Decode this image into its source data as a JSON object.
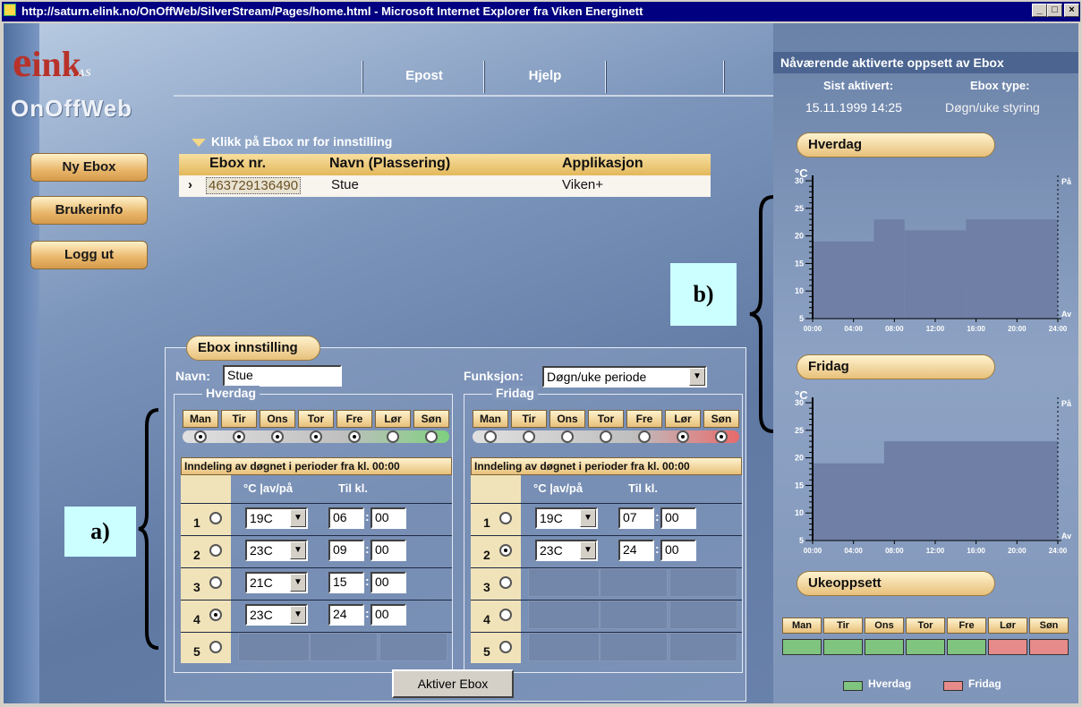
{
  "window": {
    "title": "http://saturn.elink.no/OnOffWeb/SilverStream/Pages/home.html - Microsoft Internet Explorer fra Viken Energinett",
    "min_label": "_",
    "max_label": "□",
    "close_label": "×"
  },
  "logo": {
    "line1": "ink",
    "line1_suffix": "AS",
    "line2": "OnOffWeb"
  },
  "topnav": {
    "items": [
      "Epost",
      "Hjelp"
    ]
  },
  "sidebar": {
    "buttons": [
      "Ny Ebox",
      "Brukerinfo",
      "Logg ut"
    ]
  },
  "ebox_list": {
    "heading": "Klikk på Ebox nr for innstilling",
    "columns": [
      "Ebox nr.",
      "Navn (Plassering)",
      "Applikasjon"
    ],
    "rows": [
      {
        "ebox_nr": "463729136490",
        "navn": "Stue",
        "applikasjon": "Viken+"
      }
    ]
  },
  "annotations": {
    "a": "a)",
    "b": "b)"
  },
  "settings": {
    "title": "Ebox innstilling",
    "navn_label": "Navn:",
    "navn_value": "Stue",
    "funksjon_label": "Funksjon:",
    "funksjon_value": "Døgn/uke periode",
    "days": [
      "Man",
      "Tir",
      "Ons",
      "Tor",
      "Fre",
      "Lør",
      "Søn"
    ],
    "hverdag": {
      "title": "Hverdag",
      "selected_days": [
        true,
        true,
        true,
        true,
        true,
        false,
        false
      ],
      "division_label": "Inndeling av døgnet i perioder fra kl. 00:00",
      "col_temp": "°C |av/på",
      "col_til": "Til kl.",
      "periods": [
        {
          "n": "1",
          "on": false,
          "temp": "19C",
          "hh": "06",
          "mm": "00"
        },
        {
          "n": "2",
          "on": false,
          "temp": "23C",
          "hh": "09",
          "mm": "00"
        },
        {
          "n": "3",
          "on": false,
          "temp": "21C",
          "hh": "15",
          "mm": "00"
        },
        {
          "n": "4",
          "on": true,
          "temp": "23C",
          "hh": "24",
          "mm": "00"
        },
        {
          "n": "5",
          "on": false,
          "temp": "",
          "hh": "",
          "mm": ""
        }
      ]
    },
    "fridag": {
      "title": "Fridag",
      "selected_days": [
        false,
        false,
        false,
        false,
        false,
        true,
        true
      ],
      "division_label": "Inndeling av døgnet i perioder fra kl. 00:00",
      "col_temp": "°C |av/på",
      "col_til": "Til kl.",
      "periods": [
        {
          "n": "1",
          "on": false,
          "temp": "19C",
          "hh": "07",
          "mm": "00"
        },
        {
          "n": "2",
          "on": true,
          "temp": "23C",
          "hh": "24",
          "mm": "00"
        },
        {
          "n": "3",
          "on": false,
          "temp": "",
          "hh": "",
          "mm": ""
        },
        {
          "n": "4",
          "on": false,
          "temp": "",
          "hh": "",
          "mm": ""
        },
        {
          "n": "5",
          "on": false,
          "temp": "",
          "hh": "",
          "mm": ""
        }
      ]
    },
    "aktiver_label": "Aktiver Ebox"
  },
  "right_panel": {
    "header": "Nåværende aktiverte oppsett av Ebox",
    "sist_label": "Sist aktivert:",
    "sist_value": "15.11.1999 14:25",
    "type_label": "Ebox type:",
    "type_value": "Døgn/uke styring",
    "week_title": "Ukeoppsett",
    "week_days": [
      "Man",
      "Tir",
      "Ons",
      "Tor",
      "Fre",
      "Lør",
      "Søn"
    ],
    "week_types": [
      "hverdag",
      "hverdag",
      "hverdag",
      "hverdag",
      "hverdag",
      "fridag",
      "fridag"
    ],
    "legend": [
      "Hverdag",
      "Fridag"
    ],
    "colors": {
      "hverdag": "#7fc47f",
      "fridag": "#e68a8a",
      "chart_fill": "#6f7fa6"
    }
  },
  "chart_data": [
    {
      "type": "area",
      "title": "Hverdag",
      "ylabel": "°C",
      "y_right_labels": [
        "På",
        "Av"
      ],
      "x_ticks": [
        "00:00",
        "04:00",
        "08:00",
        "12:00",
        "16:00",
        "20:00",
        "24:00"
      ],
      "y_ticks": [
        "5",
        "10",
        "15",
        "20",
        "25",
        "30"
      ],
      "ylim": [
        5,
        30
      ],
      "steps": [
        {
          "from_hour": 0,
          "to_hour": 6,
          "value": 19
        },
        {
          "from_hour": 6,
          "to_hour": 9,
          "value": 23
        },
        {
          "from_hour": 9,
          "to_hour": 15,
          "value": 21
        },
        {
          "from_hour": 15,
          "to_hour": 24,
          "value": 23
        }
      ]
    },
    {
      "type": "area",
      "title": "Fridag",
      "ylabel": "°C",
      "y_right_labels": [
        "På",
        "Av"
      ],
      "x_ticks": [
        "00:00",
        "04:00",
        "08:00",
        "12:00",
        "16:00",
        "20:00",
        "24:00"
      ],
      "y_ticks": [
        "5",
        "10",
        "15",
        "20",
        "25",
        "30"
      ],
      "ylim": [
        5,
        30
      ],
      "steps": [
        {
          "from_hour": 0,
          "to_hour": 7,
          "value": 19
        },
        {
          "from_hour": 7,
          "to_hour": 24,
          "value": 23
        }
      ]
    }
  ]
}
